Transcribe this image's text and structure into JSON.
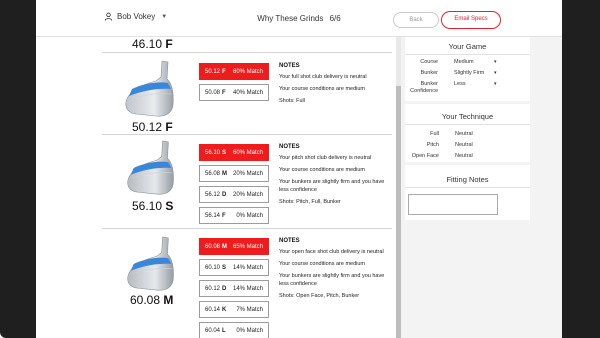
{
  "header": {
    "user_name": "Bob Vokey",
    "title": "Why These Grinds",
    "progress": "6/6",
    "back_label": "Back",
    "email_label": "Email Specs"
  },
  "previous_wedge": {
    "loft": "46.10",
    "grind": "F"
  },
  "wedges": [
    {
      "loft": "50.12",
      "grind": "F",
      "options": [
        {
          "loft": "50.12",
          "grind": "F",
          "match": "60% Match",
          "selected": true
        },
        {
          "loft": "50.08",
          "grind": "F",
          "match": "40% Match",
          "selected": false
        }
      ],
      "notes_title": "NOTES",
      "notes": [
        "Your full shot club delivery is neutral",
        "Your course conditions are medium",
        "Shots: Full"
      ]
    },
    {
      "loft": "56.10",
      "grind": "S",
      "options": [
        {
          "loft": "56.10",
          "grind": "S",
          "match": "60% Match",
          "selected": true
        },
        {
          "loft": "56.08",
          "grind": "M",
          "match": "20% Match",
          "selected": false
        },
        {
          "loft": "56.12",
          "grind": "D",
          "match": "20% Match",
          "selected": false
        },
        {
          "loft": "56.14",
          "grind": "F",
          "match": "0% Match",
          "selected": false
        }
      ],
      "notes_title": "NOTES",
      "notes": [
        "Your pitch shot club delivery is neutral",
        "Your course conditions are medium",
        "Your bunkers are slightly firm and you have less confidence",
        "Shots: Pitch, Full, Bunker"
      ]
    },
    {
      "loft": "60.08",
      "grind": "M",
      "options": [
        {
          "loft": "60.08",
          "grind": "M",
          "match": "65% Match",
          "selected": true
        },
        {
          "loft": "60.10",
          "grind": "S",
          "match": "14% Match",
          "selected": false
        },
        {
          "loft": "60.12",
          "grind": "D",
          "match": "14% Match",
          "selected": false
        },
        {
          "loft": "60.14",
          "grind": "K",
          "match": "7% Match",
          "selected": false
        },
        {
          "loft": "60.04",
          "grind": "L",
          "match": "0% Match",
          "selected": false
        }
      ],
      "notes_title": "NOTES",
      "notes": [
        "Your open face shot club delivery is neutral",
        "Your course conditions are medium",
        "Your bunkers are slightly firm and you have less confidence",
        "Shots: Open Face, Pitch, Bunker"
      ]
    }
  ],
  "your_game": {
    "title": "Your Game",
    "rows": [
      {
        "label": "Course",
        "value": "Medium"
      },
      {
        "label": "Bunker",
        "value": "Slightly Firm"
      },
      {
        "label": "Bunker Confidence",
        "value": "Less"
      }
    ]
  },
  "your_technique": {
    "title": "Your Technique",
    "rows": [
      {
        "label": "Full",
        "value": "Neutral"
      },
      {
        "label": "Pitch",
        "value": "Neutral"
      },
      {
        "label": "Open Face",
        "value": "Neutral"
      }
    ]
  },
  "fitting_notes": {
    "title": "Fitting Notes",
    "value": ""
  },
  "colors": {
    "accent": "#ee1c1c",
    "text": "#222222",
    "panel_bg": "#f3f3f3"
  },
  "icons": {
    "user": "user-icon",
    "dropdown": "chevron-down-icon",
    "caret": "caret-down-icon"
  }
}
